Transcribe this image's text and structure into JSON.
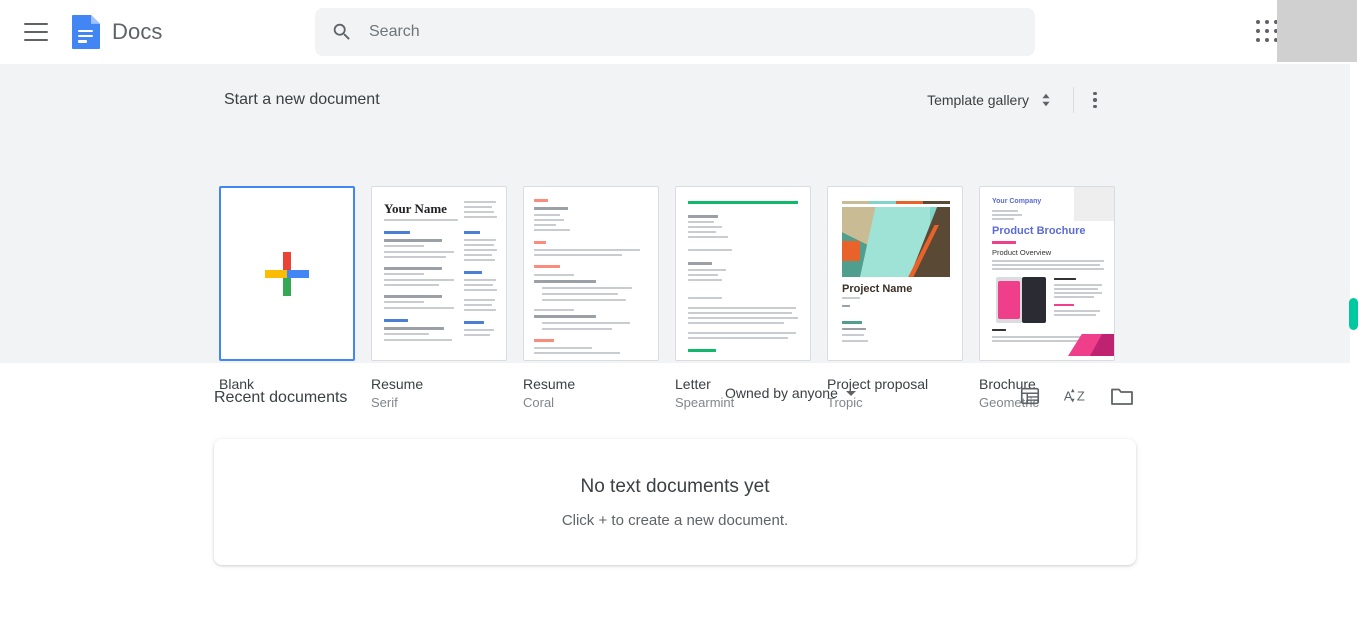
{
  "header": {
    "menu_icon": "hamburger-menu-icon",
    "logo_icon": "google-docs-logo",
    "app_title": "Docs",
    "search": {
      "icon": "search-icon",
      "placeholder": "Search",
      "value": ""
    },
    "apps_icon": "google-apps-grid-icon",
    "avatar": "account-avatar"
  },
  "templates_section": {
    "title": "Start a new document",
    "gallery_button": "Template gallery",
    "gallery_chevrons_icon": "chevron-up-down-icon",
    "more_icon": "more-vertical-icon",
    "items": [
      {
        "name": "Blank",
        "sub": "",
        "thumb": "blank-plus-thumbnail",
        "selected": true
      },
      {
        "name": "Resume",
        "sub": "Serif",
        "thumb": "resume-serif-thumbnail",
        "selected": false
      },
      {
        "name": "Resume",
        "sub": "Coral",
        "thumb": "resume-coral-thumbnail",
        "selected": false
      },
      {
        "name": "Letter",
        "sub": "Spearmint",
        "thumb": "letter-spearmint-thumbnail",
        "selected": false
      },
      {
        "name": "Project proposal",
        "sub": "Tropic",
        "thumb": "project-proposal-tropic-thumbnail",
        "selected": false
      },
      {
        "name": "Brochure",
        "sub": "Geometric",
        "thumb": "brochure-geometric-thumbnail",
        "selected": false
      }
    ],
    "thumb_text": {
      "resume_serif_title": "Your Name",
      "tropic_title": "Project Name",
      "brochure_company": "Your Company",
      "brochure_title": "Product Brochure",
      "brochure_overview": "Product Overview"
    }
  },
  "recent_section": {
    "title": "Recent documents",
    "owner_filter": "Owned by anyone",
    "owner_caret_icon": "caret-down-icon",
    "list_view_icon": "list-view-icon",
    "sort_icon": "sort-az-icon",
    "folder_icon": "folder-icon",
    "empty_state": {
      "title": "No text documents yet",
      "subtitle": "Click + to create a new document."
    }
  },
  "colors": {
    "brand_blue": "#4285f4",
    "google_red": "#ea4335",
    "google_yellow": "#fbbc04",
    "google_green": "#34a853",
    "band_background": "#f1f3f4",
    "scrollbar_accent": "#00c9a0"
  },
  "scrollbar": {
    "thumb": "scrollbar-thumb"
  }
}
